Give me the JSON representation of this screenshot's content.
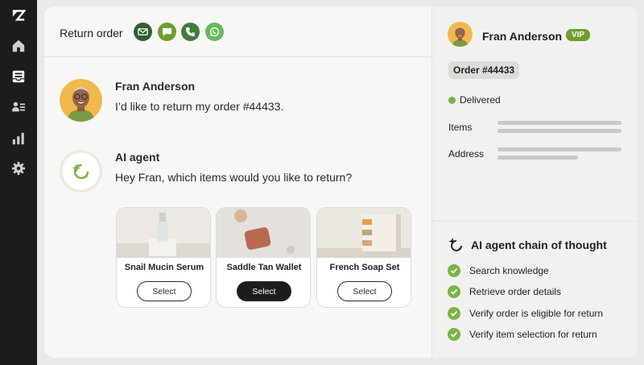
{
  "sidebar": {
    "items": [
      {
        "icon": "zendesk-logo-icon"
      },
      {
        "icon": "home-icon"
      },
      {
        "icon": "inbox-icon"
      },
      {
        "icon": "contacts-icon"
      },
      {
        "icon": "reporting-icon"
      },
      {
        "icon": "settings-icon"
      }
    ]
  },
  "conversation": {
    "title": "Return order",
    "channels": [
      {
        "icon": "email-icon",
        "color": "#2f5f2f"
      },
      {
        "icon": "chat-icon",
        "color": "#6a9f2e"
      },
      {
        "icon": "phone-icon",
        "color": "#3f7d3a"
      },
      {
        "icon": "whatsapp-icon",
        "color": "#66b85a"
      }
    ],
    "messages": [
      {
        "author": "Fran Anderson",
        "text": "I’d like to return my order #44433."
      },
      {
        "author": "AI agent",
        "text": "Hey Fran, which items would you like to return?"
      }
    ],
    "products": [
      {
        "name": "Snail Mucin Serum",
        "button": "Select",
        "selected": false
      },
      {
        "name": "Saddle Tan Wallet",
        "button": "Select",
        "selected": true
      },
      {
        "name": "French Soap Set",
        "button": "Select",
        "selected": false
      }
    ]
  },
  "customer": {
    "name": "Fran Anderson",
    "badge": "VIP",
    "order": "Order #44433",
    "status": "Delivered",
    "fields": [
      "Items",
      "Address"
    ]
  },
  "chain_of_thought": {
    "title": "AI agent chain of thought",
    "steps": [
      "Search knowledge",
      "Retrieve order details",
      "Verify order is eligible for return",
      "Verify item selection for return"
    ]
  },
  "colors": {
    "accent": "#7cb342",
    "vip": "#6f9e2b",
    "sidebar": "#1c1c1c"
  }
}
